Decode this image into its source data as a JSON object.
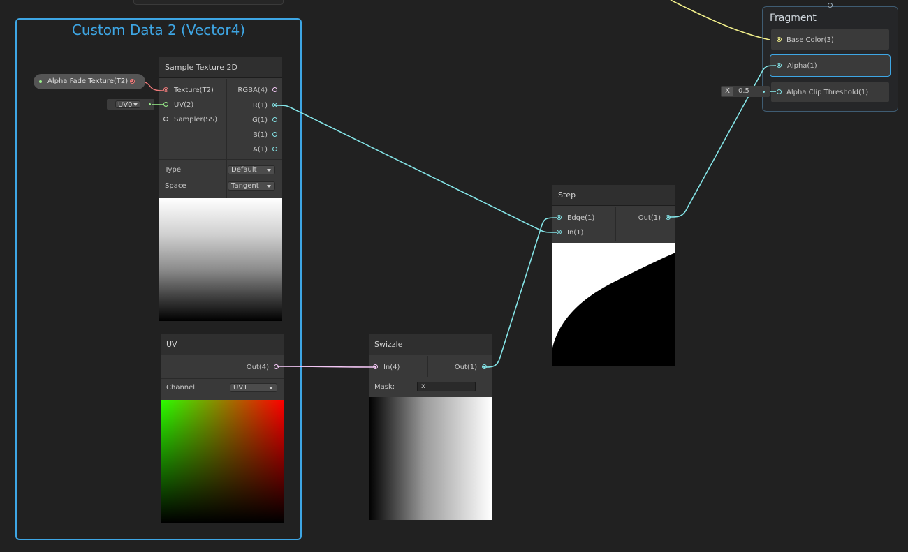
{
  "group": {
    "title": "Custom Data 2 (Vector4)"
  },
  "property": {
    "label": "Alpha Fade Texture(T2)"
  },
  "uv_selector": {
    "value": "UV0"
  },
  "sample_texture": {
    "title": "Sample Texture 2D",
    "inputs": [
      "Texture(T2)",
      "UV(2)",
      "Sampler(SS)"
    ],
    "outputs": [
      "RGBA(4)",
      "R(1)",
      "G(1)",
      "B(1)",
      "A(1)"
    ],
    "type_label": "Type",
    "type_value": "Default",
    "space_label": "Space",
    "space_value": "Tangent"
  },
  "uv_node": {
    "title": "UV",
    "output": "Out(4)",
    "channel_label": "Channel",
    "channel_value": "UV1"
  },
  "swizzle": {
    "title": "Swizzle",
    "input": "In(4)",
    "output": "Out(1)",
    "mask_label": "Mask:",
    "mask_value": "x"
  },
  "step": {
    "title": "Step",
    "inputs": [
      "Edge(1)",
      "In(1)"
    ],
    "output": "Out(1)"
  },
  "fragment": {
    "title": "Fragment",
    "slots": [
      "Base Color(3)",
      "Alpha(1)",
      "Alpha Clip Threshold(1)"
    ]
  },
  "threshold_input": {
    "axis": "X",
    "value": "0.5"
  },
  "colors": {
    "group_border": "#3ea6e4",
    "wire_float": "#84e4e7",
    "wire_vector4": "#f2c6f4",
    "wire_vector3": "#f1ef8a",
    "wire_texture": "#f07b7b",
    "wire_vector2": "#9bf28c"
  }
}
